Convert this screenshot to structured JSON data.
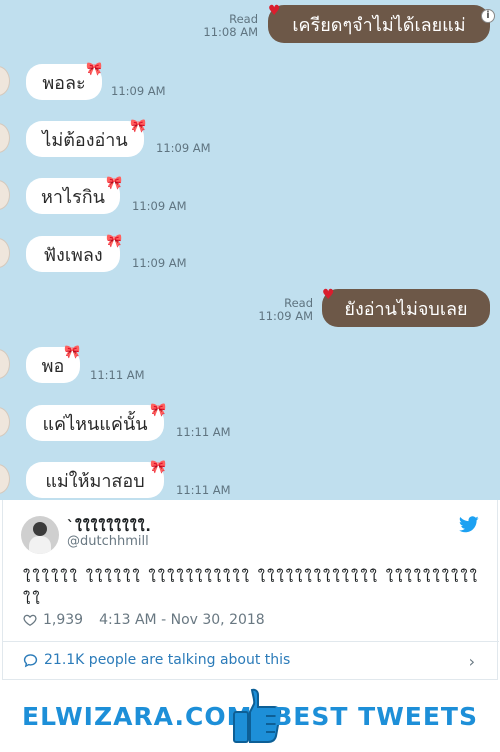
{
  "chat": {
    "top_message": {
      "text": "เครียดๆจำไม่ได้เลยแม่",
      "status": "Read",
      "time": "11:08 AM"
    },
    "incoming": [
      {
        "text": "พอละ",
        "time": "11:09 AM"
      },
      {
        "text": "ไม่ต้องอ่าน",
        "time": "11:09 AM"
      },
      {
        "text": "หาไรกิน",
        "time": "11:09 AM"
      },
      {
        "text": "ฟังเพลง",
        "time": "11:09 AM"
      }
    ],
    "mid_message": {
      "text": "ยังอ่านไม่จบเลย",
      "status": "Read",
      "time": "11:09 AM"
    },
    "incoming2": [
      {
        "text": "พอ",
        "time": "11:11 AM"
      },
      {
        "text": "แค่ไหนแค่นั้น",
        "time": "11:11 AM"
      },
      {
        "text": "แม่ให้มาสอบ",
        "time": "11:11 AM"
      }
    ],
    "colors": {
      "background": "#c0dfee",
      "outgoing": "#6d5848",
      "incoming": "#ffffff",
      "bow": "#d91e2e"
    }
  },
  "tweet": {
    "name": "`ใใใใใใใใใ.",
    "handle": "@dutchhmill",
    "text": "ใใใใใใ ใใใใใใ ใใใใใใใใใใใ ใใใใใใใใใใใใใ ใใใใใใใใใใใใ",
    "likes": "1,939",
    "timestamp": "4:13 AM - Nov 30, 2018",
    "conversation": "21.1K people are talking about this",
    "icons": {
      "brand": "twitter-bird-icon",
      "like": "heart-outline-icon",
      "reply": "speech-bubble-icon"
    }
  },
  "banner": {
    "left": "ELWIZARA.COM",
    "right": "BEST TWEETS",
    "color": "#1d8fd8",
    "icon": "thumbs-up-icon"
  }
}
